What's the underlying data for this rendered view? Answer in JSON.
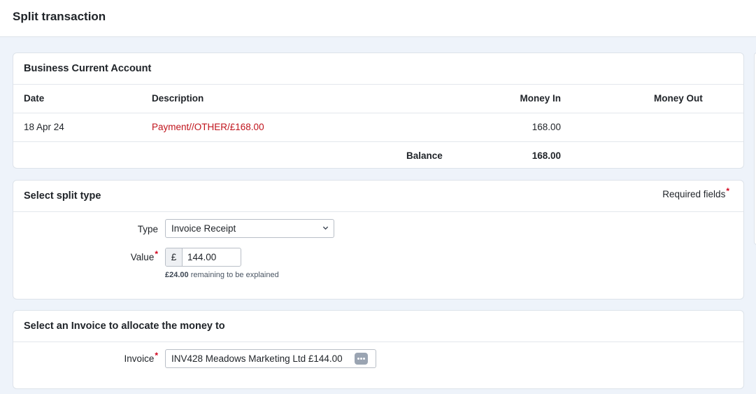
{
  "page": {
    "title": "Split transaction"
  },
  "account": {
    "title": "Business Current Account",
    "headers": {
      "date": "Date",
      "description": "Description",
      "money_in": "Money In",
      "money_out": "Money Out"
    },
    "rows": [
      {
        "date": "18 Apr 24",
        "description": "Payment//OTHER/£168.00",
        "money_in": "168.00",
        "money_out": ""
      }
    ],
    "balance_label": "Balance",
    "balance_value": "168.00"
  },
  "split": {
    "title": "Select split type",
    "required_note": "Required fields",
    "required_marker": "*",
    "type_label": "Type",
    "type_value": "Invoice Receipt",
    "value_label": "Value",
    "currency_symbol": "£",
    "value": "144.00",
    "remaining_amount": "£24.00",
    "remaining_text": " remaining to be explained"
  },
  "invoice": {
    "title": "Select an Invoice to allocate the money to",
    "label": "Invoice",
    "value": "INV428 Meadows Marketing Ltd £144.00",
    "picker_icon": "ellipsis-icon"
  },
  "colors": {
    "link": "#c0141c",
    "required": "#d0021b",
    "background": "#eef3fa"
  }
}
